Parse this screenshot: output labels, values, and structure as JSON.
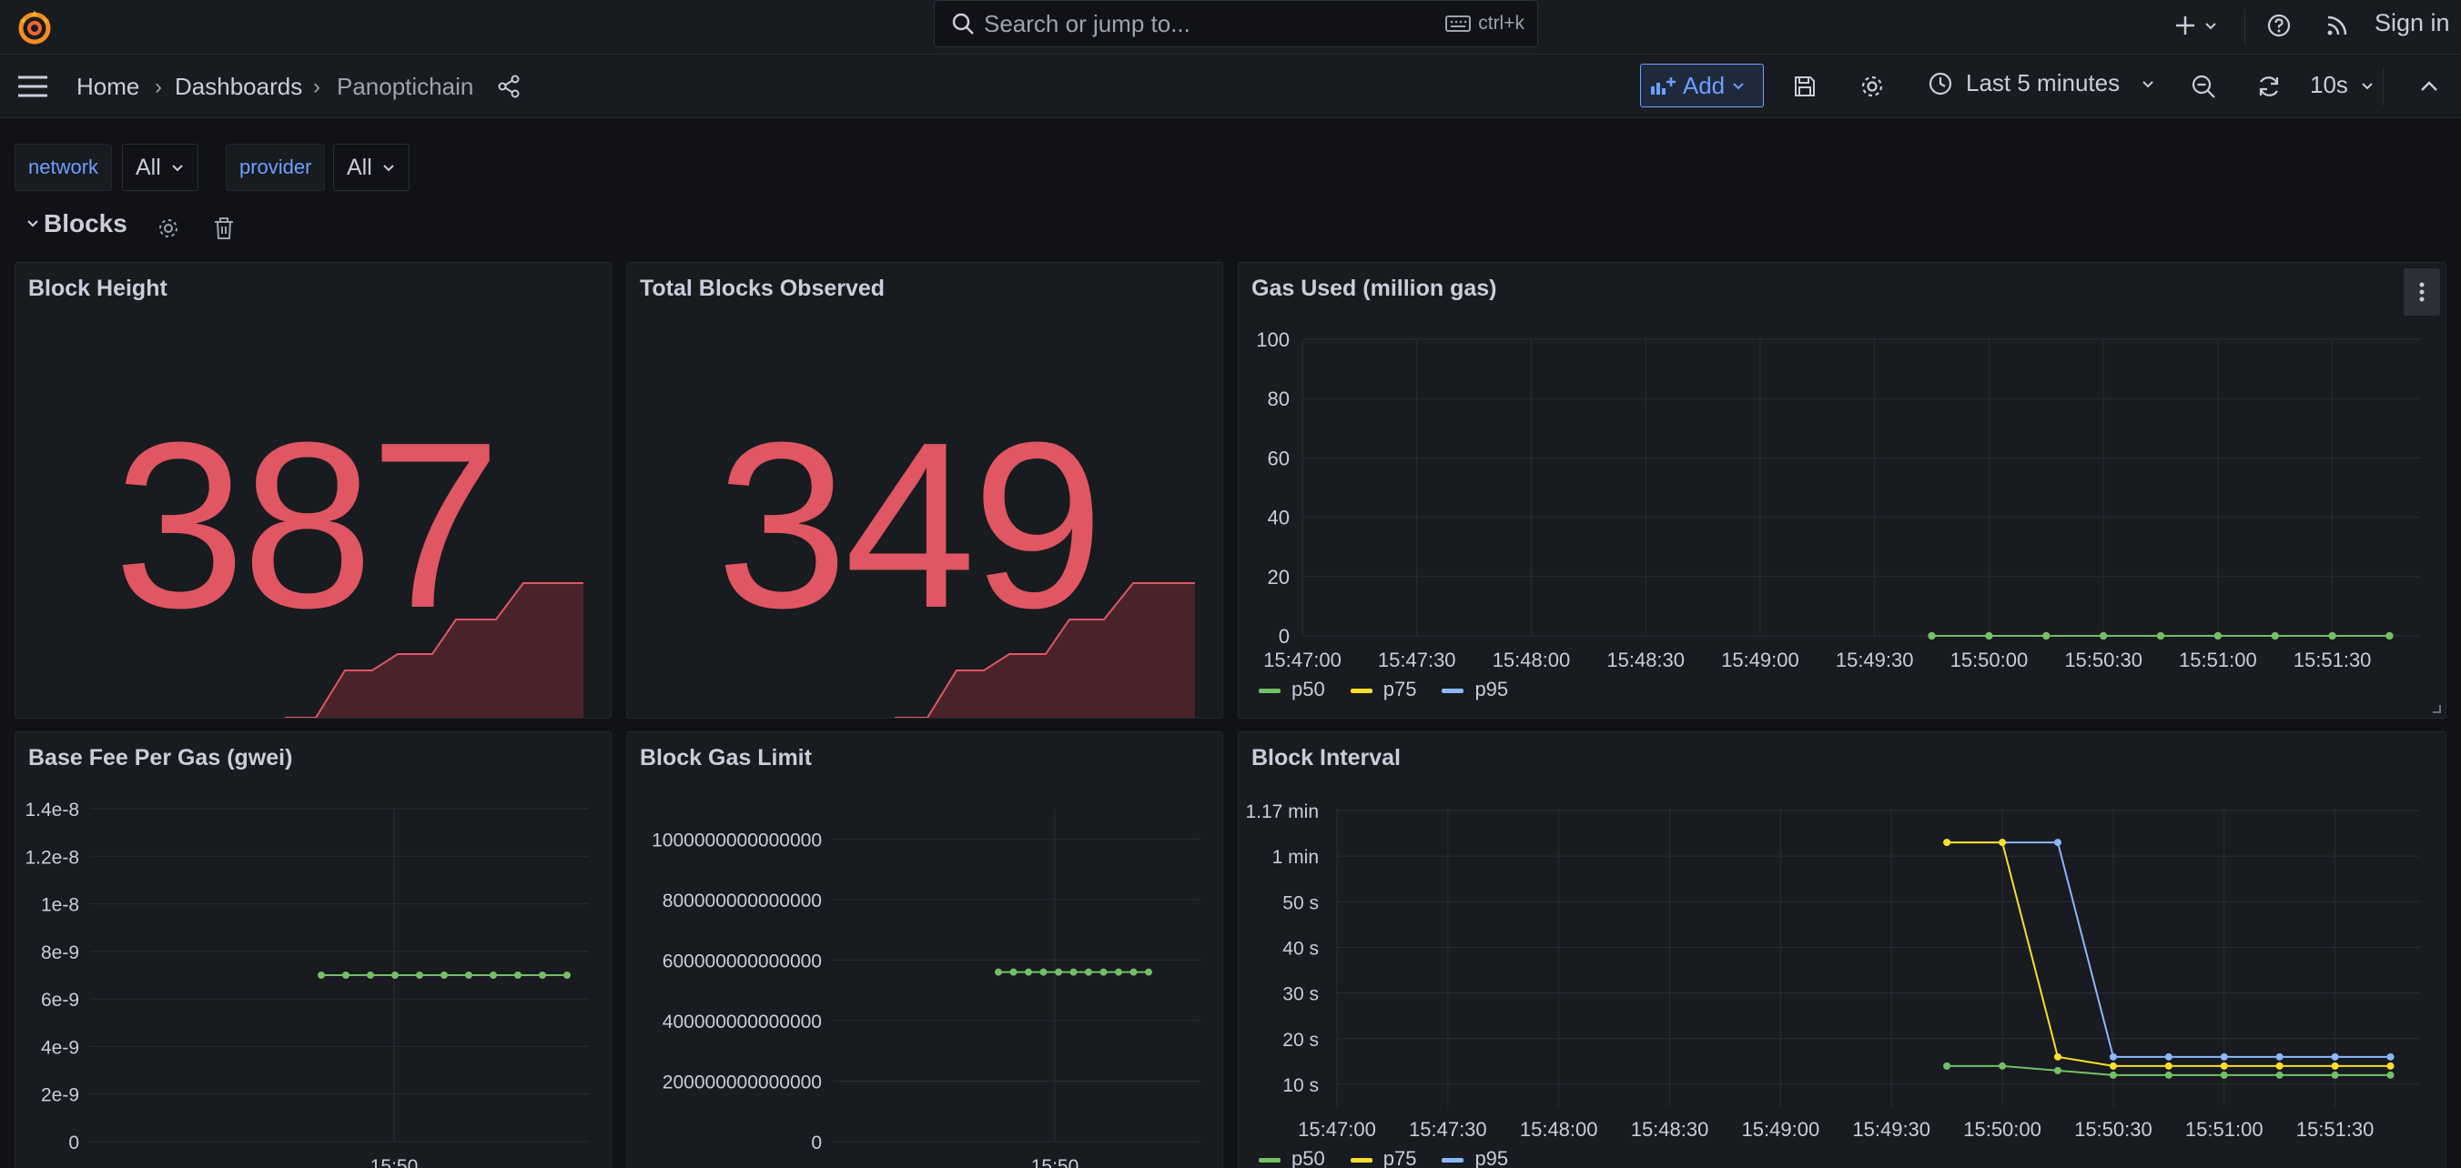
{
  "topbar": {
    "search_placeholder": "Search or jump to...",
    "search_shortcut": "ctrl+k",
    "sign_in": "Sign in"
  },
  "navbar": {
    "breadcrumbs": [
      "Home",
      "Dashboards",
      "Panoptichain"
    ],
    "add_label": "Add",
    "time_range": "Last 5 minutes",
    "refresh_interval": "10s"
  },
  "variables": [
    {
      "label": "network",
      "value": "All"
    },
    {
      "label": "provider",
      "value": "All"
    }
  ],
  "row": {
    "title": "Blocks"
  },
  "colors": {
    "stat_red": "#e05663",
    "p50": "#73bf69",
    "p75": "#fade2a",
    "p95": "#8ab8ff",
    "accent": "#6e9fff"
  },
  "panels": {
    "block_height": {
      "title": "Block Height",
      "value": "387"
    },
    "total_blocks": {
      "title": "Total Blocks Observed",
      "value": "349"
    },
    "gas_used": {
      "title": "Gas Used (million gas)"
    },
    "base_fee": {
      "title": "Base Fee Per Gas (gwei)"
    },
    "gas_limit": {
      "title": "Block Gas Limit"
    },
    "block_interval": {
      "title": "Block Interval"
    }
  },
  "legend": [
    "p50",
    "p75",
    "p95"
  ],
  "chart_data": [
    {
      "type": "line",
      "title": "Gas Used (million gas)",
      "x_ticks": [
        "15:47:00",
        "15:47:30",
        "15:48:00",
        "15:48:30",
        "15:49:00",
        "15:49:30",
        "15:50:00",
        "15:50:30",
        "15:51:00",
        "15:51:30"
      ],
      "y_ticks": [
        "0",
        "20",
        "40",
        "60",
        "80",
        "100"
      ],
      "ylim": [
        0,
        100
      ],
      "x": [
        "15:49:45",
        "15:50:00",
        "15:50:15",
        "15:50:30",
        "15:50:45",
        "15:51:00",
        "15:51:15",
        "15:51:30",
        "15:51:45"
      ],
      "series": [
        {
          "name": "p50",
          "values": [
            0,
            0,
            0,
            0,
            0,
            0,
            0,
            0,
            0
          ]
        },
        {
          "name": "p75",
          "values": [
            0,
            0,
            0,
            0,
            0,
            0,
            0,
            0,
            0
          ]
        },
        {
          "name": "p95",
          "values": [
            0,
            0,
            0,
            0,
            0,
            0,
            0,
            0,
            0
          ]
        }
      ]
    },
    {
      "type": "line",
      "title": "Base Fee Per Gas (gwei)",
      "x_ticks": [
        "15:50"
      ],
      "y_ticks": [
        "0",
        "2e-9",
        "4e-9",
        "6e-9",
        "8e-9",
        "1e-8",
        "1.2e-8",
        "1.4e-8"
      ],
      "ylim": [
        0,
        1.4e-08
      ],
      "series": [
        {
          "name": "",
          "values": [
            7e-09,
            7e-09,
            7e-09,
            7e-09,
            7e-09,
            7e-09,
            7e-09,
            7e-09,
            7e-09,
            7e-09,
            7e-09
          ]
        }
      ]
    },
    {
      "type": "line",
      "title": "Block Gas Limit",
      "x_ticks": [
        "15:50"
      ],
      "y_ticks": [
        "0",
        "200000000000000",
        "400000000000000",
        "600000000000000",
        "800000000000000",
        "1000000000000000"
      ],
      "ylim": [
        0,
        1100000000000000
      ],
      "series": [
        {
          "name": "",
          "values": [
            560000000000000,
            560000000000000,
            560000000000000,
            560000000000000,
            560000000000000,
            560000000000000,
            560000000000000,
            560000000000000,
            560000000000000,
            560000000000000,
            560000000000000
          ]
        }
      ]
    },
    {
      "type": "line",
      "title": "Block Interval",
      "x_ticks": [
        "15:47:00",
        "15:47:30",
        "15:48:00",
        "15:48:30",
        "15:49:00",
        "15:49:30",
        "15:50:00",
        "15:50:30",
        "15:51:00",
        "15:51:30"
      ],
      "y_ticks": [
        "10 s",
        "20 s",
        "30 s",
        "40 s",
        "50 s",
        "1 min",
        "1.17 min"
      ],
      "ylim_seconds": [
        5,
        70
      ],
      "x": [
        "15:49:45",
        "15:50:00",
        "15:50:15",
        "15:50:30",
        "15:50:45",
        "15:51:00",
        "15:51:15",
        "15:51:30",
        "15:51:45"
      ],
      "series": [
        {
          "name": "p50",
          "values": [
            14,
            14,
            13,
            12,
            12,
            12,
            12,
            12,
            12
          ]
        },
        {
          "name": "p75",
          "values": [
            63,
            63,
            16,
            14,
            14,
            14,
            14,
            14,
            14
          ]
        },
        {
          "name": "p95",
          "values": [
            63,
            63,
            63,
            16,
            16,
            16,
            16,
            16,
            16
          ]
        }
      ]
    }
  ]
}
